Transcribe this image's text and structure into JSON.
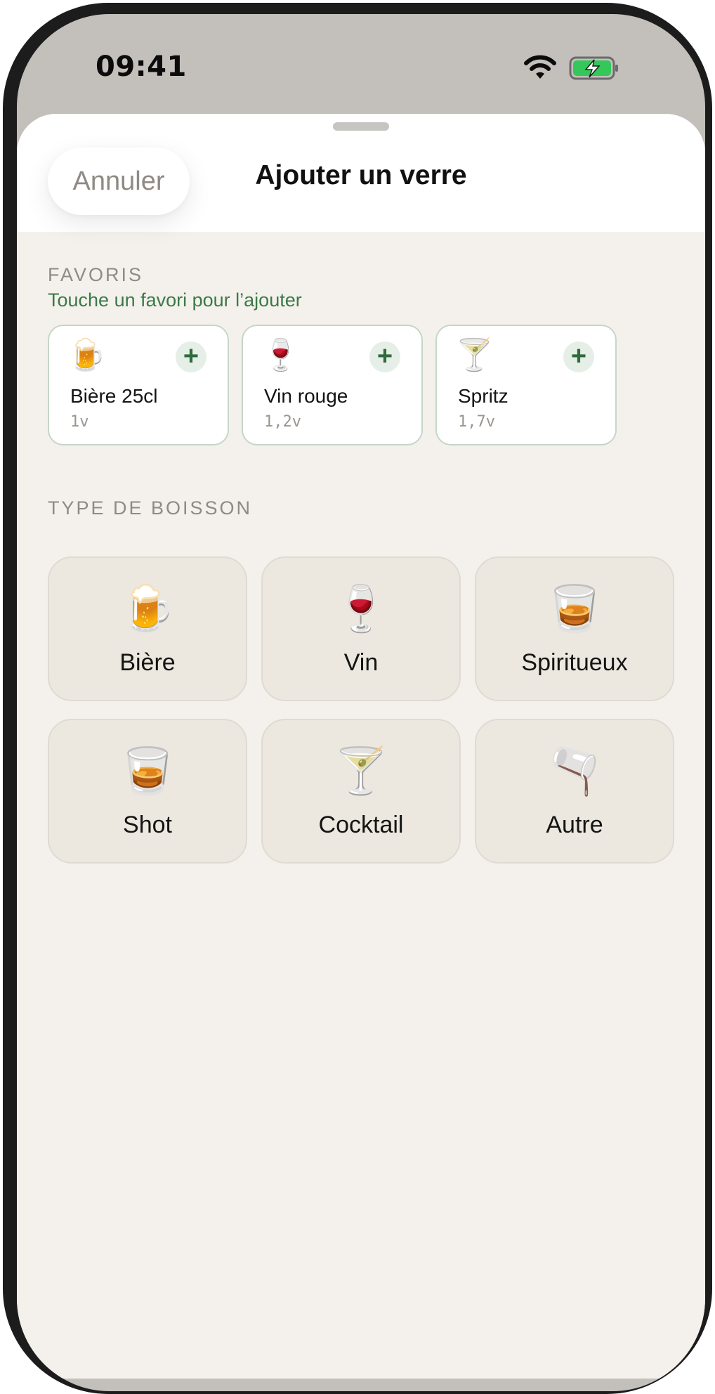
{
  "status_bar": {
    "time": "09:41",
    "wifi_icon": "wifi-icon",
    "battery_icon": "battery-charging-icon",
    "battery_color": "#34c759"
  },
  "sheet": {
    "cancel_label": "Annuler",
    "title": "Ajouter un verre"
  },
  "favorites": {
    "section_label": "FAVORIS",
    "hint": "Touche un favori pour l’ajouter",
    "items": [
      {
        "icon": "🍺",
        "icon_name": "beer-mug-icon",
        "name": "Bière 25cl",
        "units": "1v"
      },
      {
        "icon": "🍷",
        "icon_name": "wine-glass-icon",
        "name": "Vin rouge",
        "units": "1,2v"
      },
      {
        "icon": "🍸",
        "icon_name": "cocktail-glass-icon",
        "name": "Spritz",
        "units": "1,7v"
      }
    ],
    "add_icon": "+"
  },
  "drink_types": {
    "section_label": "TYPE DE BOISSON",
    "items": [
      {
        "icon": "🍺",
        "icon_name": "beer-mug-icon",
        "label": "Bière"
      },
      {
        "icon": "🍷",
        "icon_name": "wine-glass-icon",
        "label": "Vin"
      },
      {
        "icon": "🥃",
        "icon_name": "tumbler-glass-icon",
        "label": "Spiritueux"
      },
      {
        "icon": "🥃",
        "icon_name": "tumbler-glass-icon",
        "label": "Shot"
      },
      {
        "icon": "🍸",
        "icon_name": "cocktail-glass-icon",
        "label": "Cocktail"
      },
      {
        "icon": "🫗",
        "icon_name": "pouring-liquid-icon",
        "label": "Autre"
      }
    ]
  },
  "colors": {
    "accent_green": "#3a7a47",
    "sheet_background": "#f4f1ec",
    "card_background": "#ece7df"
  }
}
